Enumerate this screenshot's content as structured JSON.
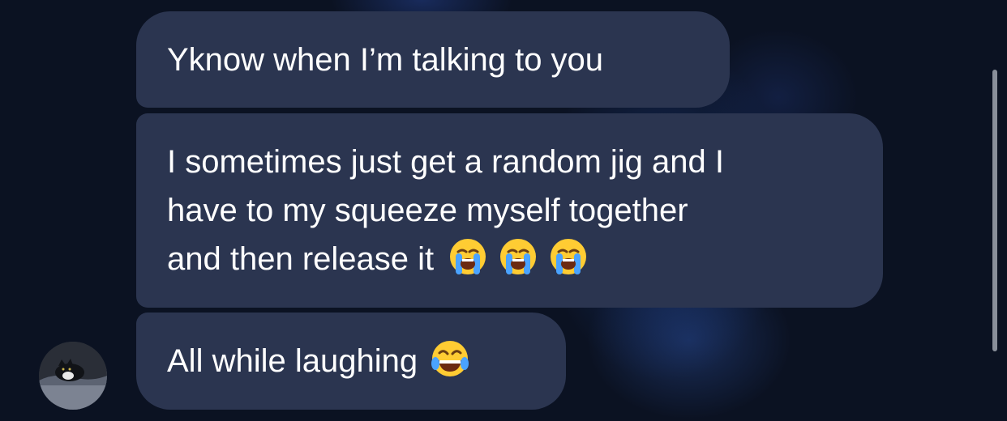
{
  "messages": [
    {
      "lines": [
        "Yknow when I’m talking to you"
      ]
    },
    {
      "lines": [
        "I sometimes just get a random jig and I",
        "have to my squeeze myself together",
        "and then release it"
      ],
      "trailing_emojis": [
        "loudly-crying-face",
        "loudly-crying-face",
        "loudly-crying-face"
      ]
    },
    {
      "lines": [
        "All while laughing"
      ],
      "trailing_emojis": [
        "face-with-tears-of-joy"
      ]
    }
  ],
  "colors": {
    "background": "#0b1222",
    "bubble": "#2b3550",
    "text": "#ffffff"
  },
  "sender": {
    "avatar": "cat-photo"
  }
}
